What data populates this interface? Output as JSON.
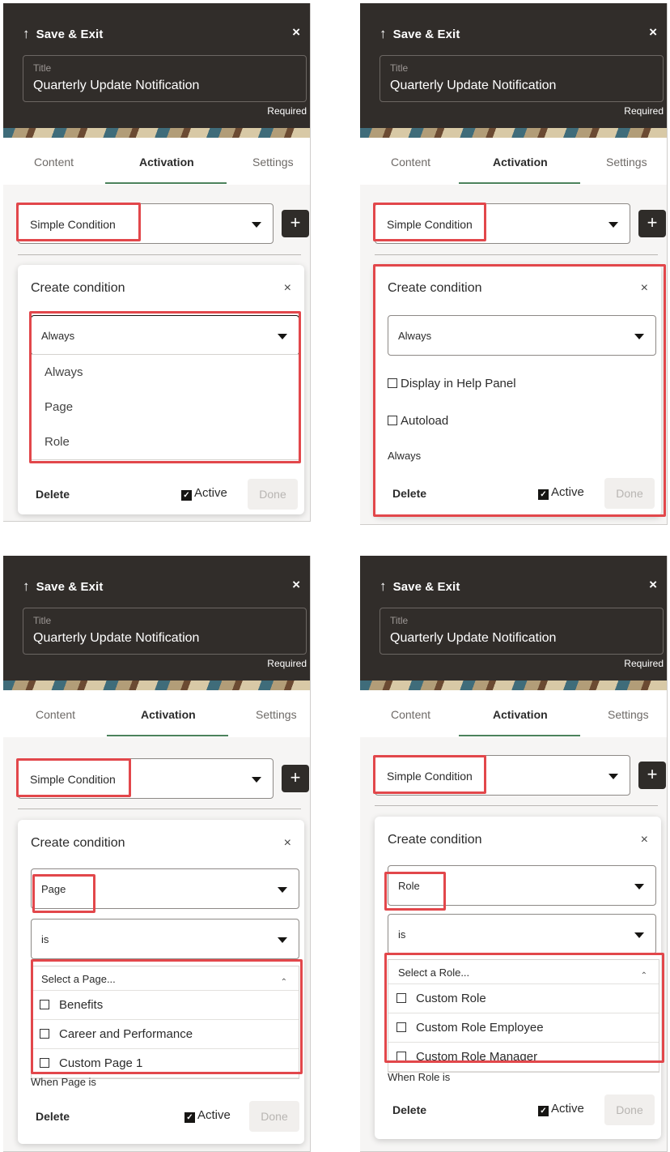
{
  "header": {
    "save_exit": "Save & Exit",
    "close": "×",
    "title_label": "Title",
    "title_value": "Quarterly Update Notification",
    "required": "Required"
  },
  "tabs": {
    "content": "Content",
    "activation": "Activation",
    "settings": "Settings"
  },
  "condition_type": "Simple Condition",
  "add_button": "+",
  "card": {
    "title": "Create condition",
    "close": "×"
  },
  "footer": {
    "delete": "Delete",
    "active": "Active",
    "done": "Done"
  },
  "panel1": {
    "selected": "Always",
    "options": [
      "Always",
      "Page",
      "Role"
    ]
  },
  "panel2": {
    "selected": "Always",
    "checkbox_help": "Display in Help Panel",
    "checkbox_autoload": "Autoload",
    "summary": "Always"
  },
  "panel3": {
    "type": "Page",
    "operator": "is",
    "list_placeholder": "Select a Page...",
    "items": [
      "Benefits",
      "Career and Performance",
      "Custom Page 1"
    ],
    "summary": "When Page is"
  },
  "panel4": {
    "type": "Role",
    "operator": "is",
    "list_placeholder": "Select a Role...",
    "items": [
      "Custom Role",
      "Custom Role Employee",
      "Custom Role Manager"
    ],
    "summary": "When Role is"
  },
  "colors": {
    "header_bg": "#312d2a",
    "highlight": "#e2474b",
    "tab_underline": "#4c825c"
  }
}
